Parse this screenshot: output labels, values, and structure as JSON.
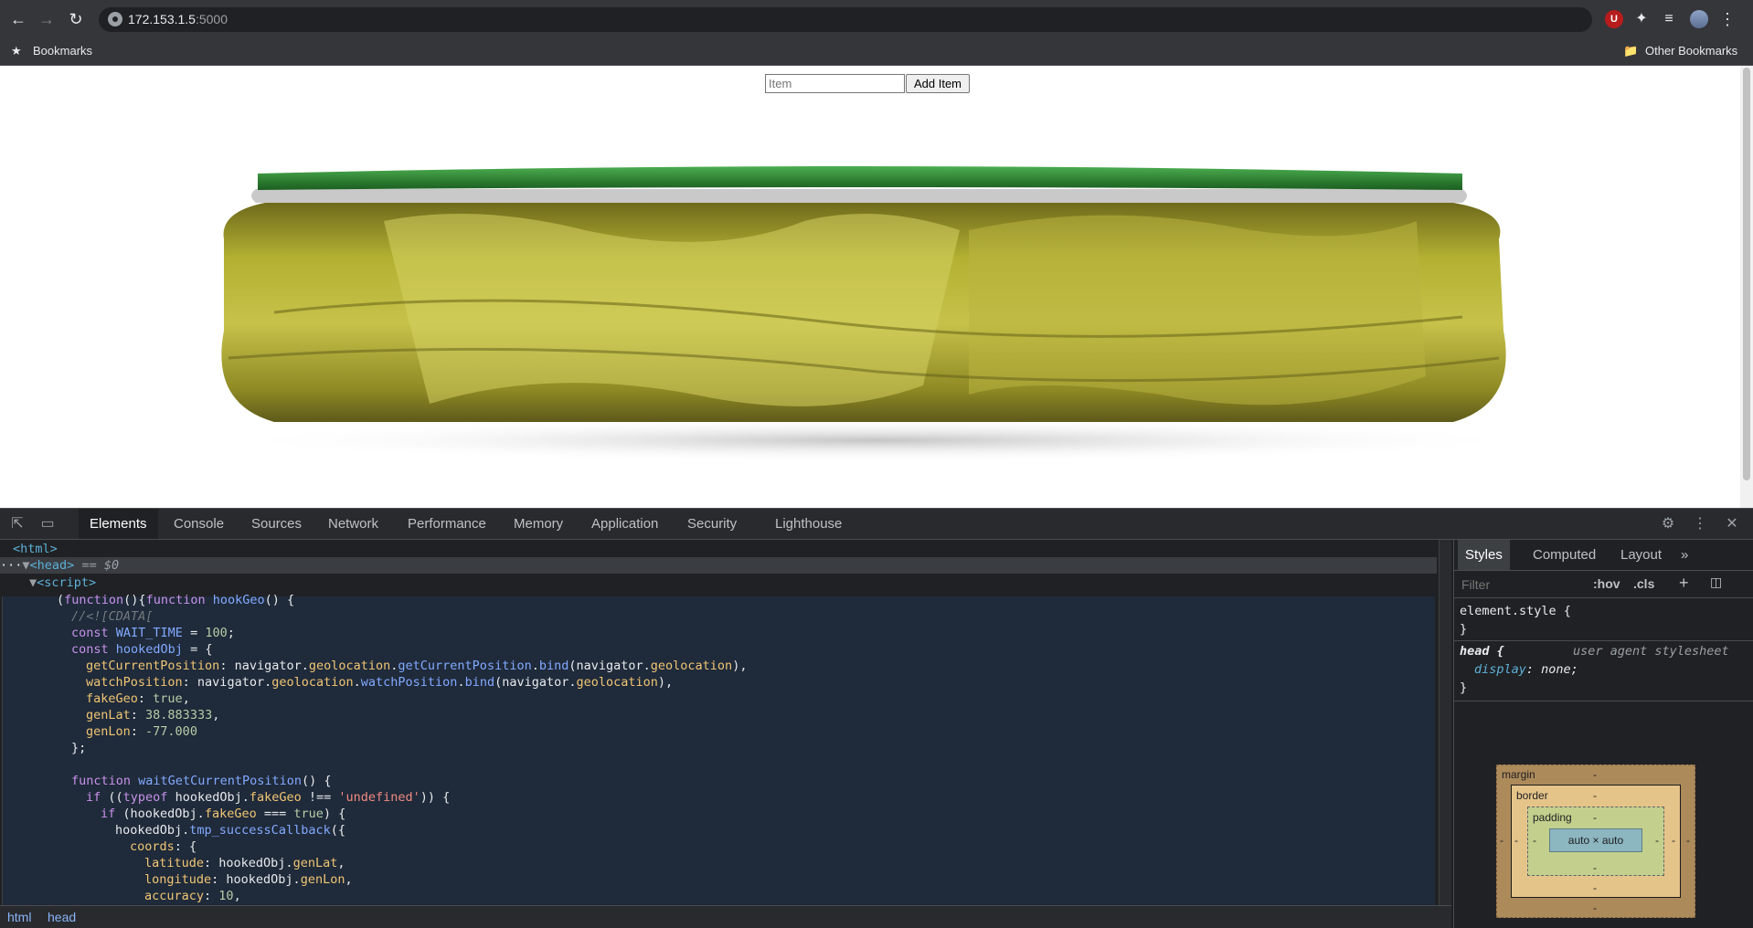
{
  "browser": {
    "url_host": "172.153.1.5",
    "url_port": ":5000",
    "bookmarks_label": "Bookmarks",
    "other_bookmarks_label": "Other Bookmarks"
  },
  "page": {
    "item_placeholder": "Item",
    "add_button_label": "Add Item",
    "image": "pickle-jar",
    "colors": {
      "lid": "#2e7d32",
      "pickle": "#a6a82a"
    }
  },
  "devtools": {
    "tabs": [
      "Elements",
      "Console",
      "Sources",
      "Network",
      "Performance",
      "Memory",
      "Application",
      "Security",
      "Lighthouse"
    ],
    "active_tab": "Elements",
    "dom": {
      "html_tag": "<html>",
      "head_tag": "<head>",
      "head_marker": "== $0",
      "script_tag": "<script>"
    },
    "code_lines": [
      "(function(){function hookGeo() {",
      "  //<![CDATA[",
      "  const WAIT_TIME = 100;",
      "  const hookedObj = {",
      "    getCurrentPosition: navigator.geolocation.getCurrentPosition.bind(navigator.geolocation),",
      "    watchPosition: navigator.geolocation.watchPosition.bind(navigator.geolocation),",
      "    fakeGeo: true,",
      "    genLat: 38.883333,",
      "    genLon: -77.000",
      "  };",
      "",
      "  function waitGetCurrentPosition() {",
      "    if ((typeof hookedObj.fakeGeo !== 'undefined')) {",
      "      if (hookedObj.fakeGeo === true) {",
      "        hookedObj.tmp_successCallback({",
      "          coords: {",
      "            latitude: hookedObj.genLat,",
      "            longitude: hookedObj.genLon,",
      "            accuracy: 10,"
    ],
    "breadcrumbs": [
      "html",
      "head"
    ],
    "styles": {
      "tabs": [
        "Styles",
        "Computed",
        "Layout"
      ],
      "active_tab": "Styles",
      "more_label": "»",
      "filter_placeholder": "Filter",
      "hov_label": ":hov",
      "cls_label": ".cls",
      "element_style_open": "element.style {",
      "close_brace": "}",
      "head_selector": "head {",
      "head_source": "user agent stylesheet",
      "head_prop": "display",
      "head_val": "none;",
      "box_model": {
        "margin_label": "margin",
        "border_label": "border",
        "padding_label": "padding",
        "content": "auto × auto",
        "dash": "-"
      }
    }
  }
}
